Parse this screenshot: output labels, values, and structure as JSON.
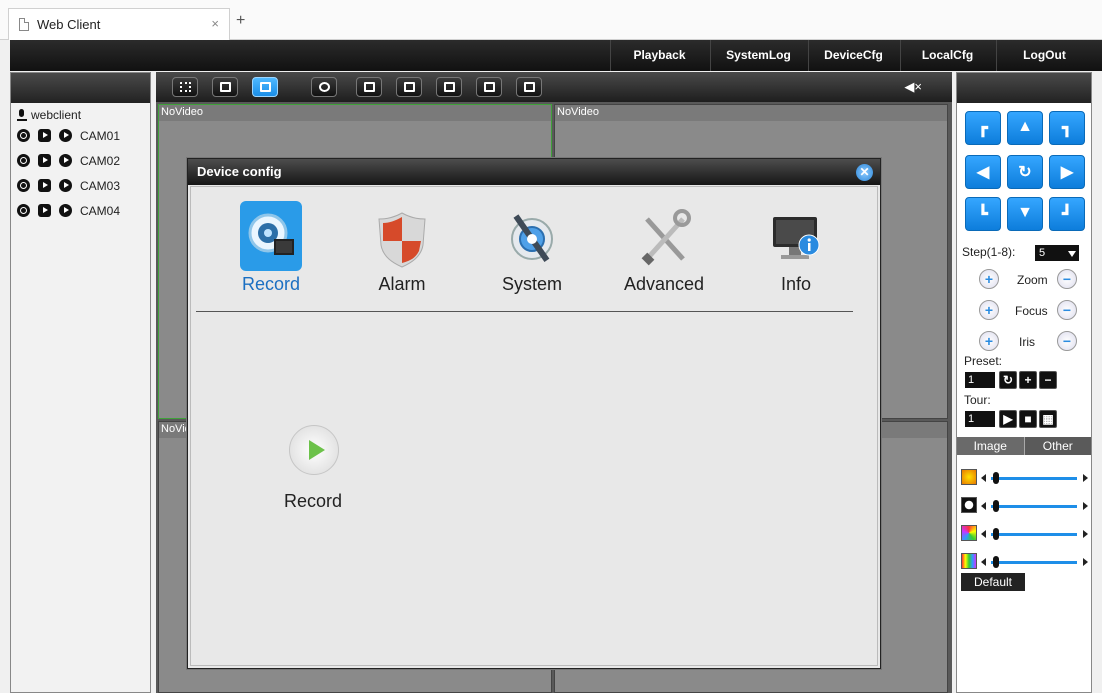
{
  "browser": {
    "tab_title": "Web Client",
    "tab_close": "×",
    "new_tab": "+"
  },
  "topnav": {
    "items": [
      "Playback",
      "SystemLog",
      "DeviceCfg",
      "LocalCfg",
      "LogOut"
    ]
  },
  "left": {
    "root_label": "webclient",
    "cameras": [
      "CAM01",
      "CAM02",
      "CAM03",
      "CAM04"
    ]
  },
  "toolbar": {
    "icons": [
      "fullscreen-icon",
      "single-view-icon",
      "quad-view-icon",
      "zoom-icon",
      "playback-icon",
      "pause-icon",
      "snapshot-icon",
      "record-icon",
      "multi-record-icon"
    ],
    "active_index": 2,
    "mute_label": "◀×"
  },
  "grid": {
    "cell_labels": [
      "NoVideo",
      "NoVideo",
      "NoVid",
      ""
    ]
  },
  "right": {
    "step_label": "Step(1-8):",
    "step_value": "5",
    "zoom_label": "Zoom",
    "focus_label": "Focus",
    "iris_label": "Iris",
    "preset_label": "Preset:",
    "preset_value": "1",
    "tour_label": "Tour:",
    "tour_value": "1",
    "tab_image": "Image",
    "tab_other": "Other",
    "default_label": "Default",
    "accent": "#1e8ee8"
  },
  "modal": {
    "title": "Device config",
    "close": "✕",
    "items": [
      "Record",
      "Alarm",
      "System",
      "Advanced",
      "Info"
    ],
    "selected": "Record",
    "sub_item": "Record"
  }
}
